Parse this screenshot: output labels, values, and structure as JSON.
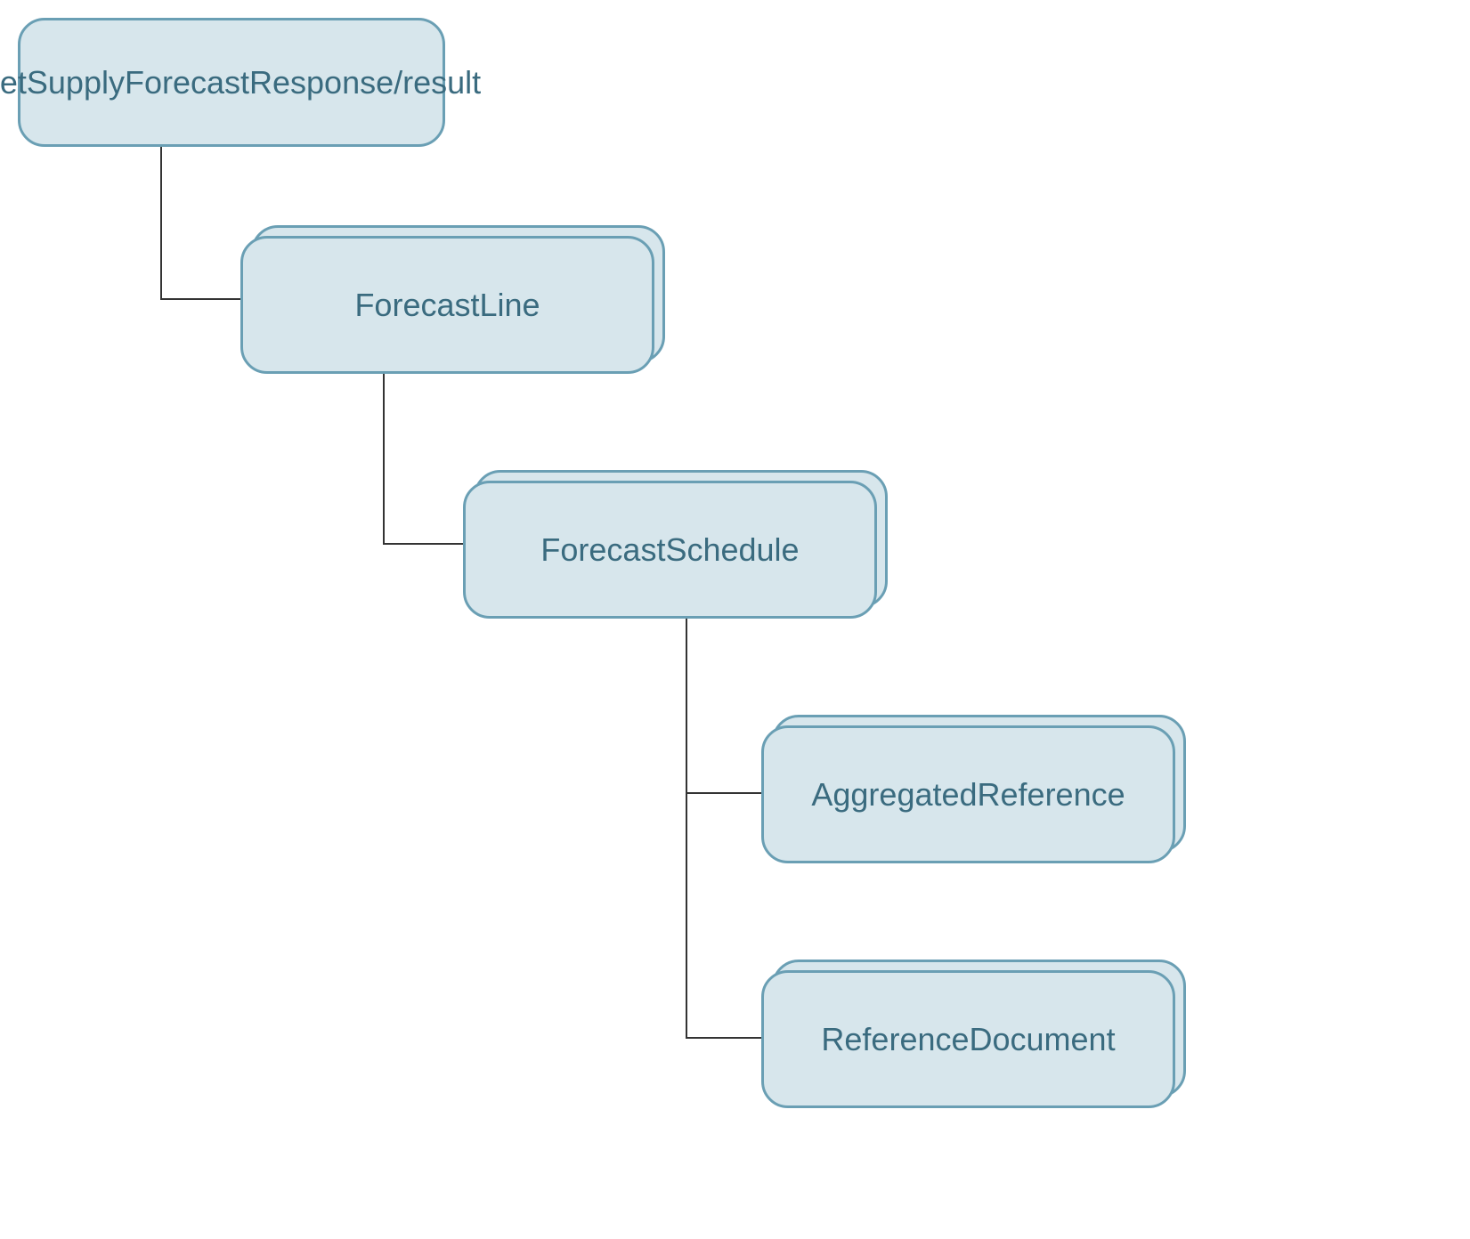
{
  "diagram": {
    "nodes": {
      "root": {
        "label": "getSupplyForecastResponse/result",
        "stacked": false
      },
      "level1": {
        "label": "ForecastLine",
        "stacked": true
      },
      "level2": {
        "label": "ForecastSchedule",
        "stacked": true
      },
      "level3a": {
        "label": "AggregatedReference",
        "stacked": true
      },
      "level3b": {
        "label": "ReferenceDocument",
        "stacked": true
      }
    }
  }
}
